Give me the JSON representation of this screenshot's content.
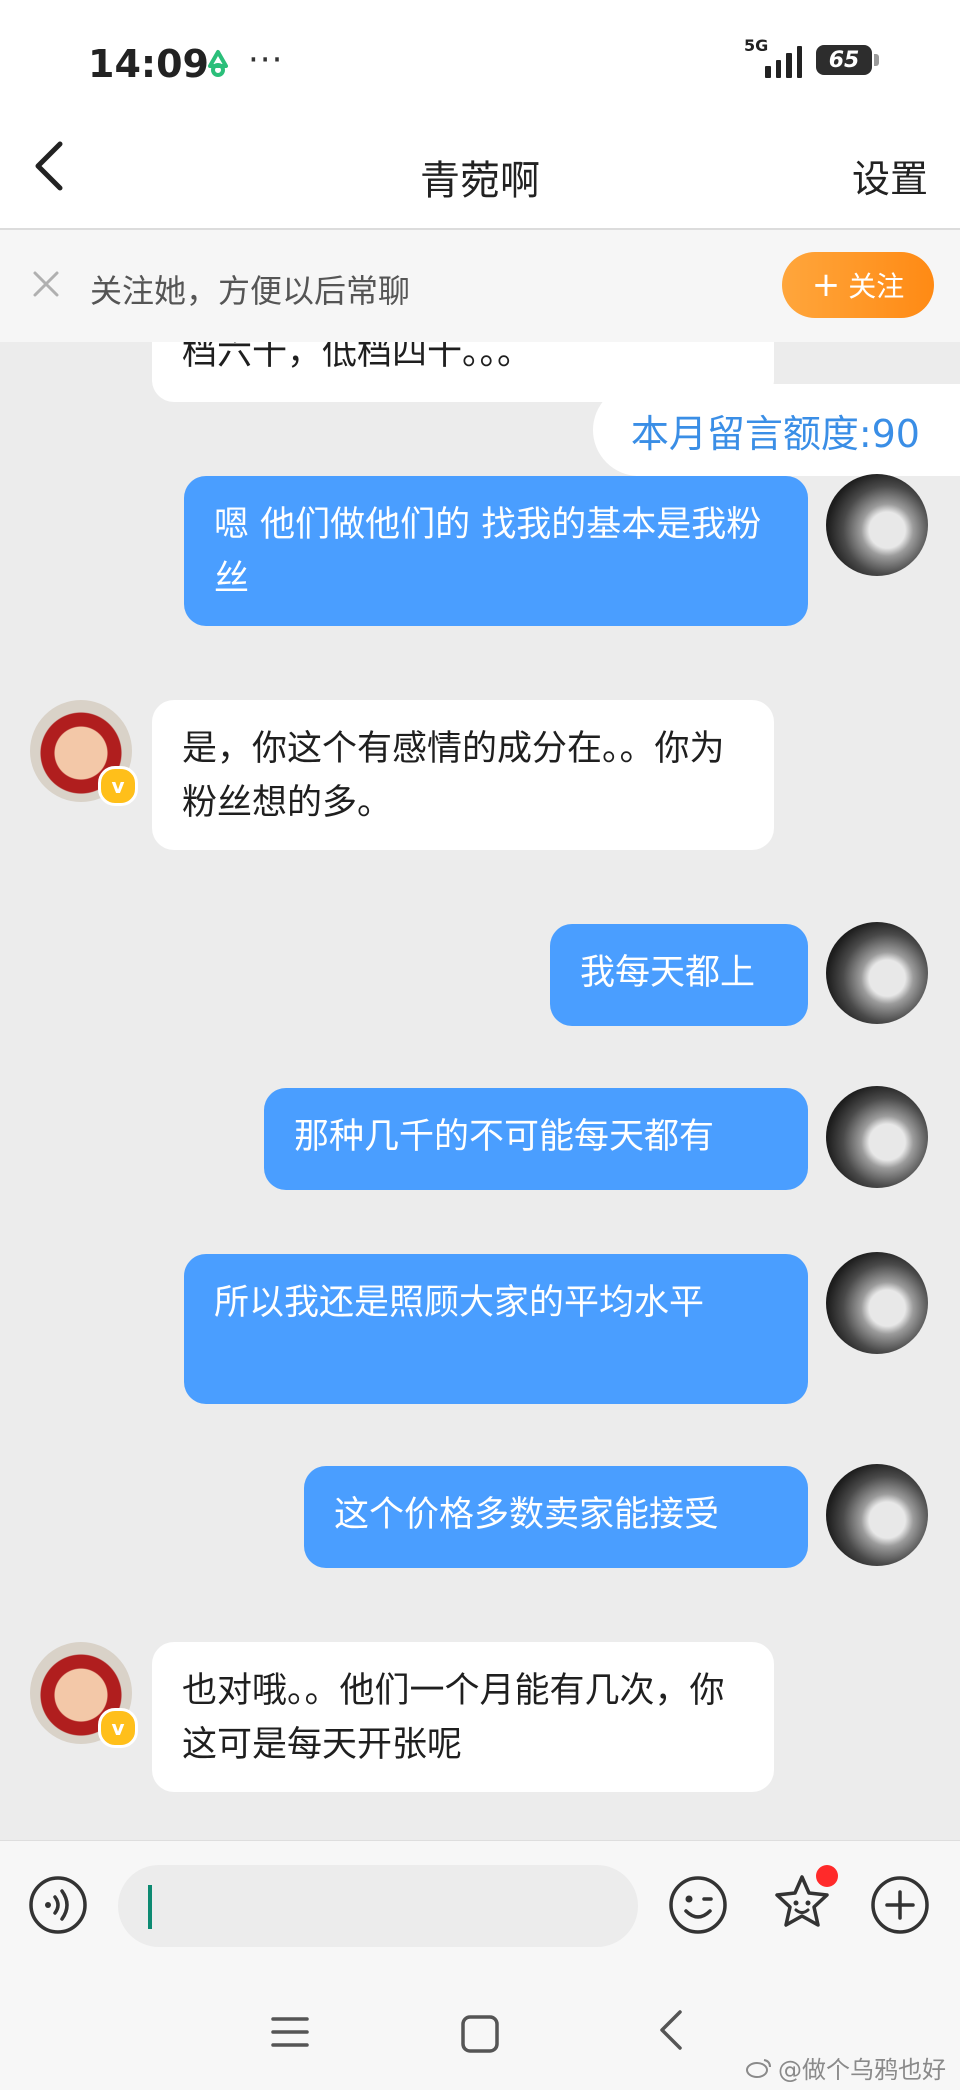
{
  "status_bar": {
    "time": "14:09",
    "dots": "···",
    "network": "5G",
    "battery": "65"
  },
  "nav": {
    "title": "青菀啊",
    "settings": "设置"
  },
  "follow_banner": {
    "text": "关注她，方便以后常聊",
    "button": "关注"
  },
  "quota": "本月留言额度:90",
  "messages": [
    {
      "side": "in",
      "text": "档六十，低档四十。。。"
    },
    {
      "side": "out",
      "text": "嗯 他们做他们的 找我的基本是我粉丝"
    },
    {
      "side": "in",
      "text": "是，你这个有感情的成分在。。你为粉丝想的多。"
    },
    {
      "side": "out",
      "text": "我每天都上"
    },
    {
      "side": "out",
      "text": "那种几千的不可能每天都有"
    },
    {
      "side": "out",
      "text": "所以我还是照顾大家的平均水平"
    },
    {
      "side": "out",
      "text": "这个价格多数卖家能接受"
    },
    {
      "side": "in",
      "text": "也对哦。。他们一个月能有几次，你这可是每天开张呢"
    }
  ],
  "watermark": "@做个乌鸦也好",
  "colors": {
    "outgoing_bubble": "#4a9eff",
    "incoming_bubble": "#ffffff",
    "follow_button": "#ff8a14",
    "quota_text": "#3a8ee6",
    "badge": "#ffbf1a"
  },
  "icons": [
    "back-icon",
    "voice-icon",
    "emoji-icon",
    "sticker-icon",
    "plus-icon",
    "menu-icon",
    "home-icon",
    "nav-back-icon",
    "weibo-icon"
  ]
}
